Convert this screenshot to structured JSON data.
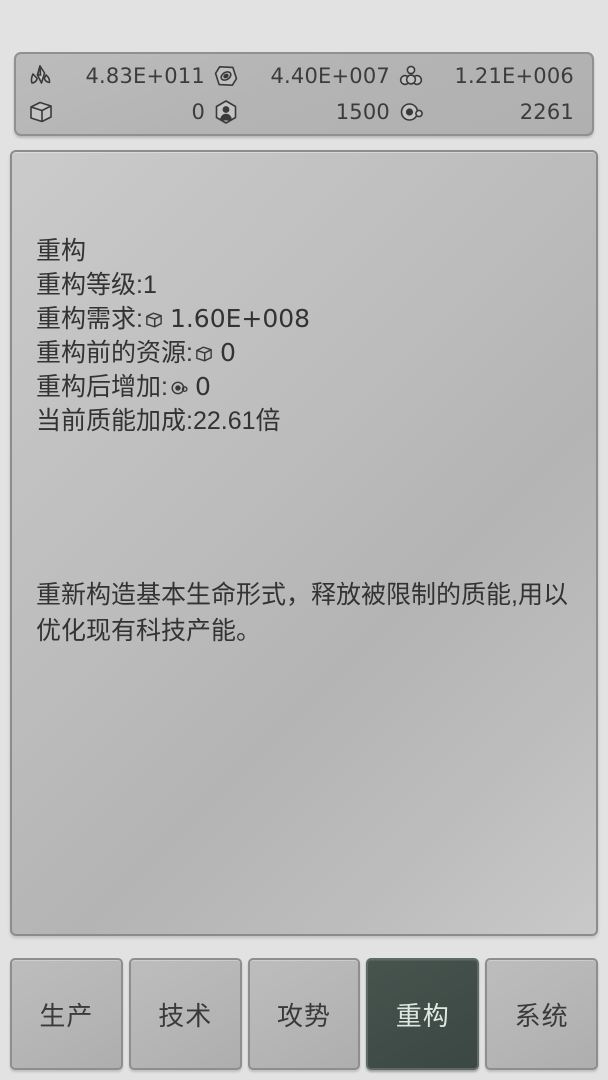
{
  "resource_bar": {
    "rows": [
      {
        "cells": [
          {
            "icon": "crystal-icon",
            "value": "4.83E+011"
          },
          {
            "icon": "alloy-icon",
            "value": "4.40E+007"
          },
          {
            "icon": "molecule-icon",
            "value": "1.21E+006"
          }
        ]
      },
      {
        "cells": [
          {
            "icon": "cube-icon",
            "value": "0"
          },
          {
            "icon": "population-icon",
            "value": "1500"
          },
          {
            "icon": "atom-icon",
            "value": "2261"
          }
        ]
      }
    ]
  },
  "main": {
    "title": "重构",
    "lines": [
      {
        "label": "重构等级:1",
        "icon": null,
        "value": null
      },
      {
        "label": "重构需求:",
        "icon": "cube-icon",
        "value": "1.60E+008"
      },
      {
        "label": "重构前的资源:",
        "icon": "cube-icon",
        "value": "0"
      },
      {
        "label": "重构后增加:",
        "icon": "atom-icon",
        "value": "0"
      },
      {
        "label": "当前质能加成:22.61倍",
        "icon": null,
        "value": null
      }
    ],
    "description": "重新构造基本生命形式，释放被限制的质能,用以优化现有科技产能。",
    "action_label": "重构"
  },
  "tabs": [
    {
      "label": "生产",
      "active": false
    },
    {
      "label": "技术",
      "active": false
    },
    {
      "label": "攻势",
      "active": false
    },
    {
      "label": "重构",
      "active": true
    },
    {
      "label": "系统",
      "active": false
    }
  ],
  "colors": {
    "background": "#e2e2e2",
    "panel": "#bababa",
    "border": "#8c8c8c",
    "text": "#333333",
    "active_tab_bg": "#414d48",
    "active_tab_text": "#dce8e0"
  }
}
